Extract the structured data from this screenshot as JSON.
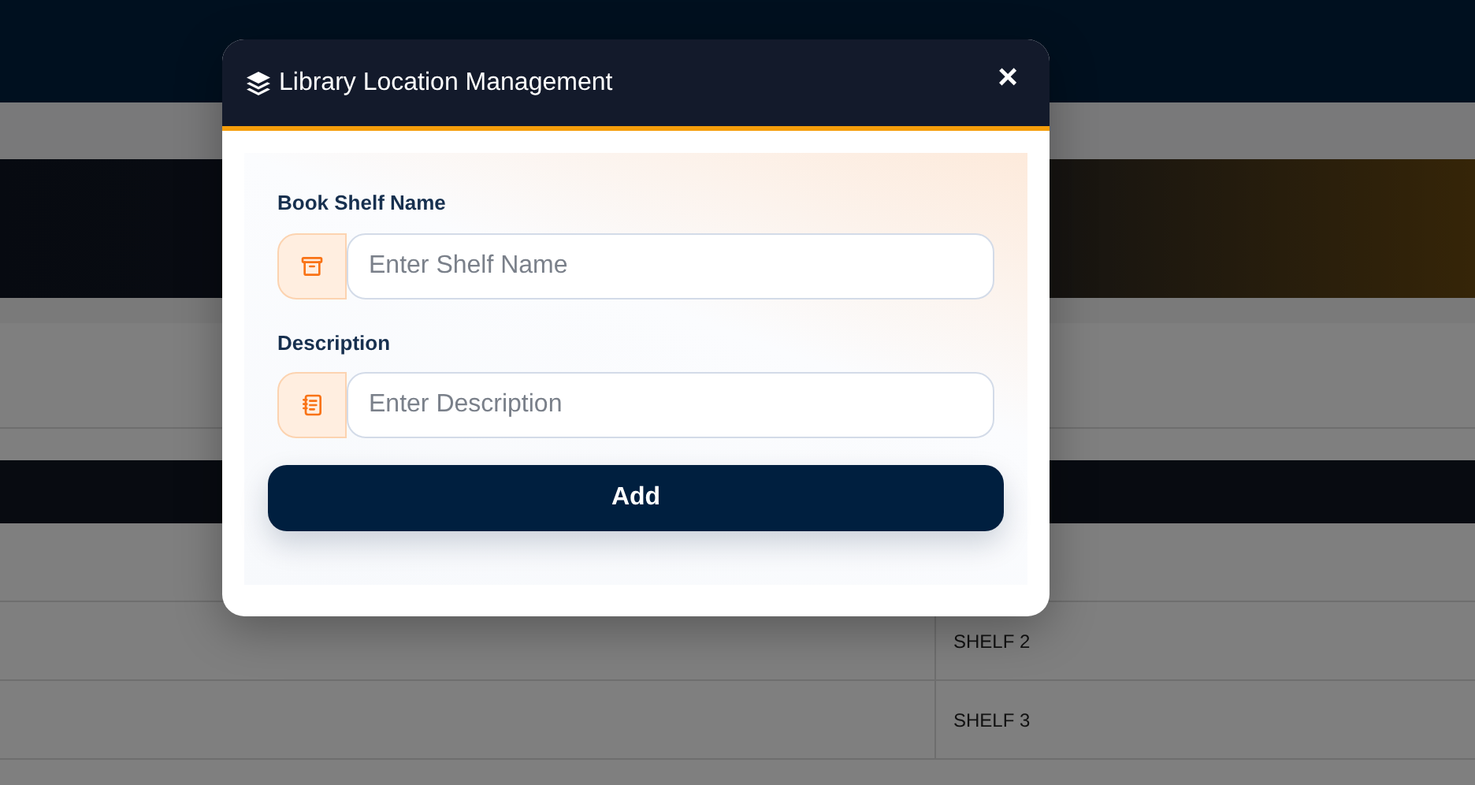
{
  "background_table": {
    "rows": [
      {
        "column_2": "SHELF 2"
      },
      {
        "column_2": "SHELF 3"
      }
    ]
  },
  "modal": {
    "title": "Library Location Management",
    "close": "×",
    "fields": [
      {
        "label": "Book Shelf Name",
        "placeholder": "Enter Shelf Name",
        "kind": "shelf"
      },
      {
        "label": "Description",
        "placeholder": "Enter Description",
        "kind": "notes"
      }
    ],
    "button": "Add"
  }
}
